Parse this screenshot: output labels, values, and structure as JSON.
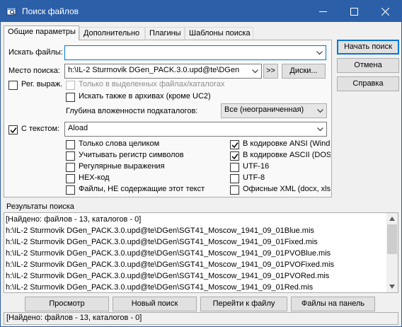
{
  "window": {
    "title": "Поиск файлов"
  },
  "tabs": [
    {
      "label": "Общие параметры"
    },
    {
      "label": "Дополнительно"
    },
    {
      "label": "Плагины"
    },
    {
      "label": "Шаблоны поиска"
    }
  ],
  "right_buttons": {
    "start": "Начать поиск",
    "cancel": "Отмена",
    "help": "Справка"
  },
  "general": {
    "search_files_label": "Искать файлы:",
    "search_files_value": "",
    "location_label": "Место поиска:",
    "location_value": "h:\\IL-2 Sturmovik DGen_PACK.3.0.upd@te\\DGen",
    "more_button": ">>",
    "drives_button": "Диски...",
    "regex_label": "Рег. выраж.",
    "only_selected_label": "Только в выделенных файлах/каталогах",
    "search_archives_label": "Искать также в архивах (кроме UC2)",
    "depth_label": "Глубина вложенности подкаталогов:",
    "depth_value": "Все (неограниченная)",
    "with_text_label": "С текстом:",
    "text_value": "Aload"
  },
  "text_options_left": [
    {
      "label": "Только слова целиком",
      "checked": false
    },
    {
      "label": "Учитывать регистр символов",
      "checked": false
    },
    {
      "label": "Регулярные выражения",
      "checked": false
    },
    {
      "label": "HEX-код",
      "checked": false
    },
    {
      "label": "Файлы, НЕ содержащие этот текст",
      "checked": false
    }
  ],
  "text_options_right": [
    {
      "label": "В кодировке ANSI (Windo",
      "checked": true
    },
    {
      "label": "В кодировке ASCII (DOS)",
      "checked": true
    },
    {
      "label": "UTF-16",
      "checked": false
    },
    {
      "label": "UTF-8",
      "checked": false
    },
    {
      "label": "Офисные XML (docx, xlsx",
      "checked": false
    }
  ],
  "results": {
    "group_label": "Результаты поиска",
    "lines": [
      " [Найдено: файлов - 13, каталогов - 0]",
      "h:\\IL-2 Sturmovik DGen_PACK.3.0.upd@te\\DGen\\SGT41_Moscow_1941_09_01Blue.mis",
      "h:\\IL-2 Sturmovik DGen_PACK.3.0.upd@te\\DGen\\SGT41_Moscow_1941_09_01Fixed.mis",
      "h:\\IL-2 Sturmovik DGen_PACK.3.0.upd@te\\DGen\\SGT41_Moscow_1941_09_01PVOBlue.mis",
      "h:\\IL-2 Sturmovik DGen_PACK.3.0.upd@te\\DGen\\SGT41_Moscow_1941_09_01PVOFixed.mis",
      "h:\\IL-2 Sturmovik DGen_PACK.3.0.upd@te\\DGen\\SGT41_Moscow_1941_09_01PVORed.mis",
      "h:\\IL-2 Sturmovik DGen_PACK.3.0.upd@te\\DGen\\SGT41_Moscow_1941_09_01Red.mis"
    ]
  },
  "bottom_buttons": {
    "view": "Просмотр",
    "new_search": "Новый поиск",
    "goto_file": "Перейти к файлу",
    "files_to_panel": "Файлы на панель"
  },
  "status": "[Найдено: файлов - 13, каталогов - 0]",
  "colors": {
    "titlebar": "#2b5fa8",
    "focus": "#0078d7"
  }
}
